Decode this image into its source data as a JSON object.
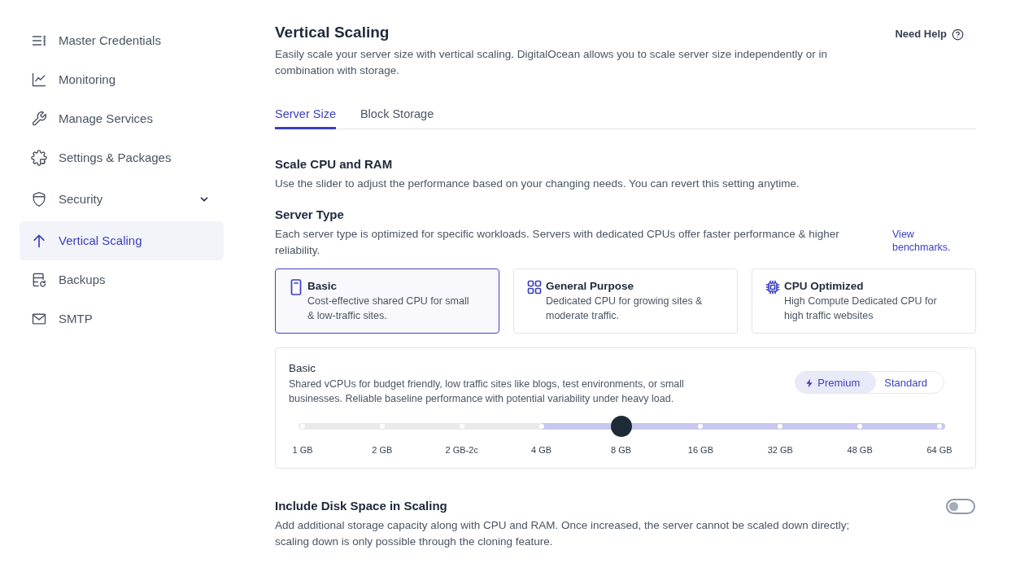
{
  "sidebar": {
    "items": [
      {
        "label": "Master Credentials",
        "selected": false
      },
      {
        "label": "Monitoring",
        "selected": false
      },
      {
        "label": "Manage Services",
        "selected": false
      },
      {
        "label": "Settings & Packages",
        "selected": false
      },
      {
        "label": "Security",
        "selected": false,
        "expanded": false
      },
      {
        "label": "Vertical Scaling",
        "selected": true
      },
      {
        "label": "Backups",
        "selected": false
      },
      {
        "label": "SMTP",
        "selected": false
      }
    ]
  },
  "page": {
    "title": "Vertical Scaling",
    "help_link": "Need Help",
    "description": "Easily scale your server size with vertical scaling. DigitalOcean allows you to scale server size independently or in combination with storage."
  },
  "tabs": [
    {
      "label": "Server Size",
      "selected": true
    },
    {
      "label": "Block Storage",
      "selected": false
    }
  ],
  "scale_section": {
    "title": "Scale CPU and RAM",
    "description": "Use the slider to adjust the performance based on your changing needs. You can revert this setting anytime."
  },
  "server_type": {
    "title": "Server Type",
    "description": "Each server type is optimized for specific workloads. Servers with dedicated CPUs offer faster performance & higher reliability.",
    "link": "View benchmarks.",
    "cards": [
      {
        "title": "Basic",
        "description": "Cost-effective shared CPU for small & low-traffic sites.",
        "selected": true
      },
      {
        "title": "General Purpose",
        "description": "Dedicated CPU for growing sites & moderate traffic.",
        "selected": false
      },
      {
        "title": "CPU Optimized",
        "description": "High Compute Dedicated CPU for high traffic websites",
        "selected": false
      }
    ]
  },
  "plan_panel": {
    "title": "Basic",
    "description": "Shared vCPUs for budget friendly, low traffic sites like blogs, test environments, or small businesses. Reliable baseline performance with potential variability under heavy load.",
    "options": [
      {
        "label": "Premium",
        "selected": true
      },
      {
        "label": "Standard",
        "selected": false
      }
    ],
    "slider": {
      "level": 0.5,
      "stops": [
        {
          "label": "1 GB",
          "available": false
        },
        {
          "label": "2 GB",
          "available": false
        },
        {
          "label": "2 GB-2c",
          "available": false
        },
        {
          "label": "4 GB",
          "available": true
        },
        {
          "label": "8 GB",
          "available": true
        },
        {
          "label": "16 GB",
          "available": true
        },
        {
          "label": "32 GB",
          "available": true
        },
        {
          "label": "48 GB",
          "available": true
        },
        {
          "label": "64 GB",
          "available": true
        }
      ]
    }
  },
  "disk_scaling": {
    "title": "Include Disk Space in Scaling",
    "description": "Add additional storage capacity along with CPU and RAM. Once increased, the server cannot be scaled down directly; scaling down is only possible through the cloning feature.",
    "on": false
  }
}
